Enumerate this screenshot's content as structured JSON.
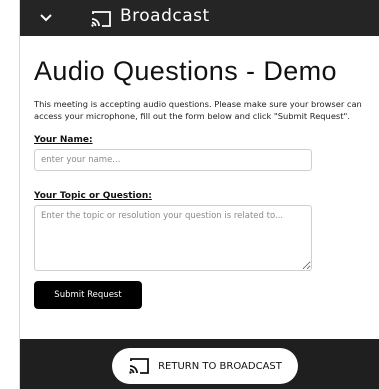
{
  "topbar": {
    "chevron_icon": "chevron-down-icon",
    "cast_icon": "cast-icon",
    "title": "Broadcast"
  },
  "page": {
    "title": "Audio Questions - Demo",
    "description": "This meeting is accepting audio questions. Please make sure your browser can access your microphone, fill out the form below and click \"Submit Request\"."
  },
  "form": {
    "name_label": "Your Name:",
    "name_placeholder": "enter your name...",
    "topic_label": "Your Topic or Question:",
    "topic_placeholder": "Enter the topic or resolution your question is related to...",
    "submit_label": "Submit Request"
  },
  "footer": {
    "return_label": "RETURN TO BROADCAST",
    "return_icon": "cast-icon"
  },
  "colors": {
    "topbar_bg": "#252525",
    "footer_bg": "#1f1f1f",
    "button_bg": "#000000"
  }
}
